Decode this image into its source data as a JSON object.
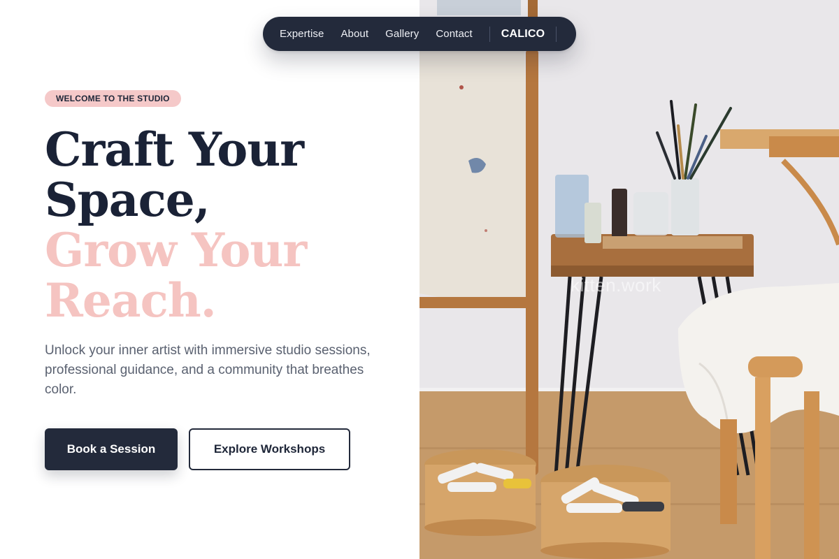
{
  "nav": {
    "links": [
      "Expertise",
      "About",
      "Gallery",
      "Contact"
    ],
    "brand": "CALICO"
  },
  "hero": {
    "badge": "WELCOME TO THE STUDIO",
    "headline_dark": [
      "Craft Your",
      "Space,"
    ],
    "headline_pink": [
      "Grow Your",
      "Reach."
    ],
    "subtext": "Unlock your inner artist with immersive studio sessions, professional guidance, and a community that breathes color.",
    "primary_button": "Book a Session",
    "secondary_button": "Explore Workshops"
  },
  "photo": {
    "watermark": "kitten.work"
  },
  "colors": {
    "navy": "#232a3b",
    "pink_accent": "#f5c4c1",
    "badge_bg": "#f5c9c9",
    "body_text": "#5a6170"
  }
}
